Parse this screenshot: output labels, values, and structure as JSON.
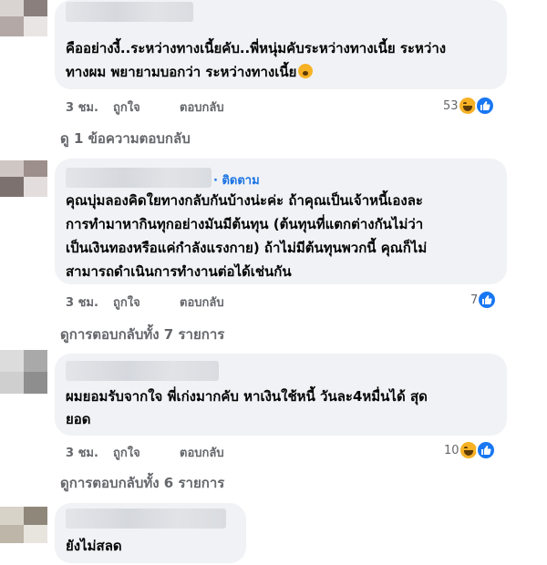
{
  "comments": [
    {
      "name_hidden": true,
      "text_lines": [
        "คืออย่างงี้..ระหว่างทางเนี้ยคับ..พี่หนุ่มคับระหว่างทางเนี้ย ระหว่าง",
        "ทางผม พยายามบอกว่า ระหว่างทางเนี้ย"
      ],
      "time": "3 ชม.",
      "like_label": "ถูกใจ",
      "reply_label": "ตอบกลับ",
      "reaction_count": "53",
      "reactions": [
        "haha-icon",
        "like-icon"
      ],
      "view_replies": "ดู 1 ข้อความตอบกลับ"
    },
    {
      "name_hidden": true,
      "follow_label": "· ติดตาม",
      "text_lines": [
        "คุณบุ่มลองคิดใยทางกลับกันบ้างน่ะค่ะ ถ้าคุณเป็นเจ้าหนี้เองละ",
        "การทำมาหากินทุกอย่างมันมีต้นทุน (ต้นทุนที่แตกต่างกันไม่ว่า",
        "เป็นเงินทองหรือแค่กำลังแรงกาย) ถ้าไม่มีต้นทุนพวกนี้ คุณก็ไม่",
        "สามารถดำเนินการทำงานต่อได้เช่นกัน"
      ],
      "time": "3 ชม.",
      "like_label": "ถูกใจ",
      "reply_label": "ตอบกลับ",
      "reaction_count": "7",
      "reactions": [
        "like-icon"
      ],
      "view_replies": "ดูการตอบกลับทั้ง 7 รายการ"
    },
    {
      "name_hidden": true,
      "text_lines": [
        "ผมยอมรับจากใจ พี่เก่งมากคับ หาเงินใช้หนี้ วันละ4หมื่นได้ สุด",
        "ยอด"
      ],
      "time": "3 ชม.",
      "like_label": "ถูกใจ",
      "reply_label": "ตอบกลับ",
      "reaction_count": "10",
      "reactions": [
        "haha-icon",
        "like-icon"
      ],
      "view_replies": "ดูการตอบกลับทั้ง 6 รายการ"
    },
    {
      "name_hidden": true,
      "text_lines": [
        "ยังไม่สลด"
      ]
    }
  ],
  "colors": {
    "bubble": "#f0f2f5",
    "action_text": "#65676b",
    "link_blue": "#1b74e4",
    "like_blue": "#1877f2",
    "haha_yellow": "#f7b125"
  }
}
